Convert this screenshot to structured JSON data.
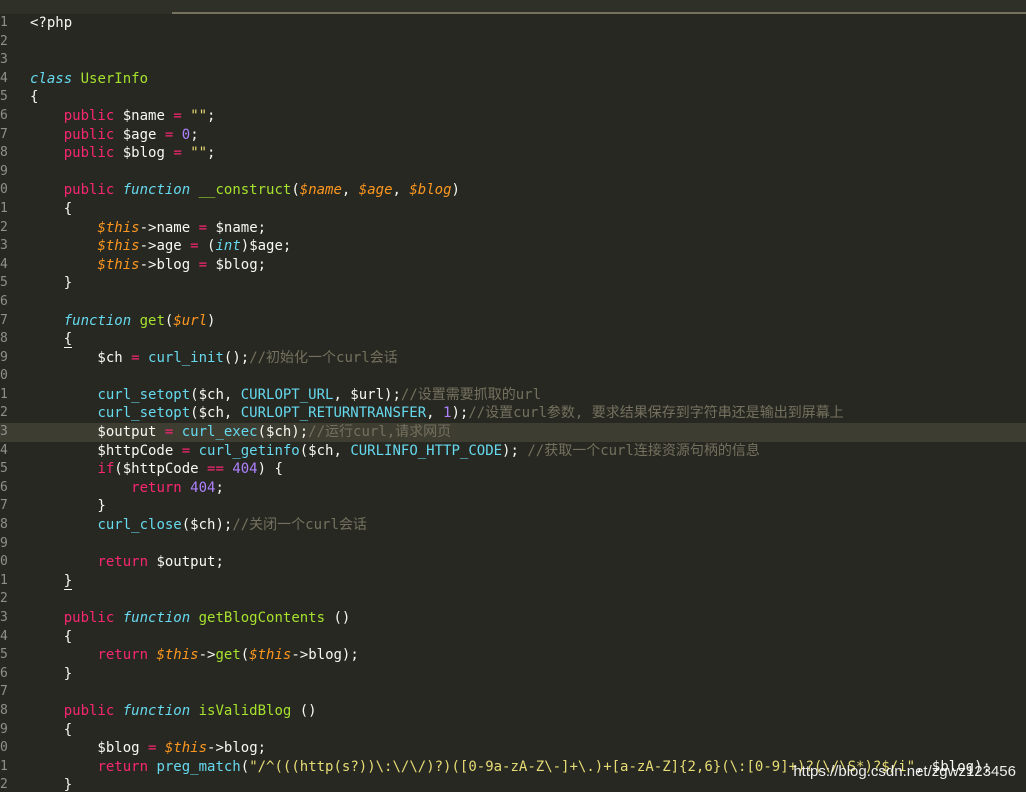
{
  "editor": {
    "current_line": 23,
    "lines": [
      {
        "n": "1",
        "tokens": [
          {
            "t": "<?php",
            "c": ""
          }
        ]
      },
      {
        "n": "2",
        "tokens": []
      },
      {
        "n": "3",
        "tokens": []
      },
      {
        "n": "4",
        "tokens": [
          {
            "t": "class",
            "c": "st"
          },
          {
            "t": " ",
            "c": ""
          },
          {
            "t": "UserInfo",
            "c": "cl"
          }
        ]
      },
      {
        "n": "5",
        "tokens": [
          {
            "t": "{",
            "c": ""
          }
        ]
      },
      {
        "n": "6",
        "tokens": [
          {
            "t": "    ",
            "c": ""
          },
          {
            "t": "public",
            "c": "kw"
          },
          {
            "t": " $name ",
            "c": ""
          },
          {
            "t": "=",
            "c": "kw"
          },
          {
            "t": " ",
            "c": ""
          },
          {
            "t": "\"\"",
            "c": "str"
          },
          {
            "t": ";",
            "c": ""
          }
        ]
      },
      {
        "n": "7",
        "tokens": [
          {
            "t": "    ",
            "c": ""
          },
          {
            "t": "public",
            "c": "kw"
          },
          {
            "t": " $age ",
            "c": ""
          },
          {
            "t": "=",
            "c": "kw"
          },
          {
            "t": " ",
            "c": ""
          },
          {
            "t": "0",
            "c": "num"
          },
          {
            "t": ";",
            "c": ""
          }
        ]
      },
      {
        "n": "8",
        "tokens": [
          {
            "t": "    ",
            "c": ""
          },
          {
            "t": "public",
            "c": "kw"
          },
          {
            "t": " $blog ",
            "c": ""
          },
          {
            "t": "=",
            "c": "kw"
          },
          {
            "t": " ",
            "c": ""
          },
          {
            "t": "\"\"",
            "c": "str"
          },
          {
            "t": ";",
            "c": ""
          }
        ]
      },
      {
        "n": "9",
        "tokens": []
      },
      {
        "n": "0",
        "tokens": [
          {
            "t": "    ",
            "c": ""
          },
          {
            "t": "public",
            "c": "kw"
          },
          {
            "t": " ",
            "c": ""
          },
          {
            "t": "function",
            "c": "st"
          },
          {
            "t": " ",
            "c": ""
          },
          {
            "t": "__construct",
            "c": "fn"
          },
          {
            "t": "(",
            "c": ""
          },
          {
            "t": "$name",
            "c": "arg"
          },
          {
            "t": ", ",
            "c": ""
          },
          {
            "t": "$age",
            "c": "arg"
          },
          {
            "t": ", ",
            "c": ""
          },
          {
            "t": "$blog",
            "c": "arg"
          },
          {
            "t": ")",
            "c": ""
          }
        ]
      },
      {
        "n": "1",
        "tokens": [
          {
            "t": "    {",
            "c": ""
          }
        ]
      },
      {
        "n": "2",
        "tokens": [
          {
            "t": "        ",
            "c": ""
          },
          {
            "t": "$this",
            "c": "arg"
          },
          {
            "t": "->name ",
            "c": ""
          },
          {
            "t": "=",
            "c": "kw"
          },
          {
            "t": " $name;",
            "c": ""
          }
        ]
      },
      {
        "n": "3",
        "tokens": [
          {
            "t": "        ",
            "c": ""
          },
          {
            "t": "$this",
            "c": "arg"
          },
          {
            "t": "->age ",
            "c": ""
          },
          {
            "t": "=",
            "c": "kw"
          },
          {
            "t": " (",
            "c": ""
          },
          {
            "t": "int",
            "c": "st"
          },
          {
            "t": ")$age;",
            "c": ""
          }
        ]
      },
      {
        "n": "4",
        "tokens": [
          {
            "t": "        ",
            "c": ""
          },
          {
            "t": "$this",
            "c": "arg"
          },
          {
            "t": "->blog ",
            "c": ""
          },
          {
            "t": "=",
            "c": "kw"
          },
          {
            "t": " $blog;",
            "c": ""
          }
        ]
      },
      {
        "n": "5",
        "tokens": [
          {
            "t": "    }",
            "c": ""
          }
        ]
      },
      {
        "n": "6",
        "tokens": []
      },
      {
        "n": "7",
        "tokens": [
          {
            "t": "    ",
            "c": ""
          },
          {
            "t": "function",
            "c": "st"
          },
          {
            "t": " ",
            "c": ""
          },
          {
            "t": "get",
            "c": "fn"
          },
          {
            "t": "(",
            "c": ""
          },
          {
            "t": "$url",
            "c": "arg"
          },
          {
            "t": ")",
            "c": ""
          }
        ]
      },
      {
        "n": "8",
        "tokens": [
          {
            "t": "    ",
            "c": ""
          },
          {
            "t": "{",
            "c": "bracket-u"
          }
        ]
      },
      {
        "n": "9",
        "tokens": [
          {
            "t": "        $ch ",
            "c": ""
          },
          {
            "t": "=",
            "c": "kw"
          },
          {
            "t": " ",
            "c": ""
          },
          {
            "t": "curl_init",
            "c": "bi"
          },
          {
            "t": "();",
            "c": ""
          },
          {
            "t": "//初始化一个curl会话",
            "c": "cm"
          }
        ]
      },
      {
        "n": "0",
        "tokens": []
      },
      {
        "n": "1",
        "tokens": [
          {
            "t": "        ",
            "c": ""
          },
          {
            "t": "curl_setopt",
            "c": "bi"
          },
          {
            "t": "($ch, ",
            "c": ""
          },
          {
            "t": "CURLOPT_URL",
            "c": "cs"
          },
          {
            "t": ", $url);",
            "c": ""
          },
          {
            "t": "//设置需要抓取的url",
            "c": "cm"
          }
        ]
      },
      {
        "n": "2",
        "tokens": [
          {
            "t": "        ",
            "c": ""
          },
          {
            "t": "curl_setopt",
            "c": "bi"
          },
          {
            "t": "($ch, ",
            "c": ""
          },
          {
            "t": "CURLOPT_RETURNTRANSFER",
            "c": "cs"
          },
          {
            "t": ", ",
            "c": ""
          },
          {
            "t": "1",
            "c": "num"
          },
          {
            "t": ");",
            "c": ""
          },
          {
            "t": "//设置curl参数, 要求结果保存到字符串还是输出到屏幕上",
            "c": "cm"
          }
        ]
      },
      {
        "n": "3",
        "tokens": [
          {
            "t": "        $output ",
            "c": ""
          },
          {
            "t": "=",
            "c": "kw"
          },
          {
            "t": " ",
            "c": ""
          },
          {
            "t": "curl_exec",
            "c": "bi"
          },
          {
            "t": "($ch);",
            "c": ""
          },
          {
            "t": "//运行curl,请求网页",
            "c": "cm"
          }
        ]
      },
      {
        "n": "4",
        "tokens": [
          {
            "t": "        $httpCode ",
            "c": ""
          },
          {
            "t": "=",
            "c": "kw"
          },
          {
            "t": " ",
            "c": ""
          },
          {
            "t": "curl_getinfo",
            "c": "bi"
          },
          {
            "t": "($ch, ",
            "c": ""
          },
          {
            "t": "CURLINFO_HTTP_CODE",
            "c": "cs"
          },
          {
            "t": "); ",
            "c": ""
          },
          {
            "t": "//获取一个curl连接资源句柄的信息",
            "c": "cm"
          }
        ]
      },
      {
        "n": "5",
        "tokens": [
          {
            "t": "        ",
            "c": ""
          },
          {
            "t": "if",
            "c": "kw"
          },
          {
            "t": "($httpCode ",
            "c": ""
          },
          {
            "t": "==",
            "c": "kw"
          },
          {
            "t": " ",
            "c": ""
          },
          {
            "t": "404",
            "c": "num"
          },
          {
            "t": ") {",
            "c": ""
          }
        ]
      },
      {
        "n": "6",
        "tokens": [
          {
            "t": "            ",
            "c": ""
          },
          {
            "t": "return",
            "c": "kw"
          },
          {
            "t": " ",
            "c": ""
          },
          {
            "t": "404",
            "c": "num"
          },
          {
            "t": ";",
            "c": ""
          }
        ]
      },
      {
        "n": "7",
        "tokens": [
          {
            "t": "        }",
            "c": ""
          }
        ]
      },
      {
        "n": "8",
        "tokens": [
          {
            "t": "        ",
            "c": ""
          },
          {
            "t": "curl_close",
            "c": "bi"
          },
          {
            "t": "($ch);",
            "c": ""
          },
          {
            "t": "//关闭一个curl会话",
            "c": "cm"
          }
        ]
      },
      {
        "n": "9",
        "tokens": []
      },
      {
        "n": "0",
        "tokens": [
          {
            "t": "        ",
            "c": ""
          },
          {
            "t": "return",
            "c": "kw"
          },
          {
            "t": " $output;",
            "c": ""
          }
        ]
      },
      {
        "n": "1",
        "tokens": [
          {
            "t": "    ",
            "c": ""
          },
          {
            "t": "}",
            "c": "bracket-u"
          }
        ]
      },
      {
        "n": "2",
        "tokens": []
      },
      {
        "n": "3",
        "tokens": [
          {
            "t": "    ",
            "c": ""
          },
          {
            "t": "public",
            "c": "kw"
          },
          {
            "t": " ",
            "c": ""
          },
          {
            "t": "function",
            "c": "st"
          },
          {
            "t": " ",
            "c": ""
          },
          {
            "t": "getBlogContents",
            "c": "fn"
          },
          {
            "t": " ()",
            "c": ""
          }
        ]
      },
      {
        "n": "4",
        "tokens": [
          {
            "t": "    {",
            "c": ""
          }
        ]
      },
      {
        "n": "5",
        "tokens": [
          {
            "t": "        ",
            "c": ""
          },
          {
            "t": "return",
            "c": "kw"
          },
          {
            "t": " ",
            "c": ""
          },
          {
            "t": "$this",
            "c": "arg"
          },
          {
            "t": "->",
            "c": ""
          },
          {
            "t": "get",
            "c": "fn"
          },
          {
            "t": "(",
            "c": ""
          },
          {
            "t": "$this",
            "c": "arg"
          },
          {
            "t": "->blog);",
            "c": ""
          }
        ]
      },
      {
        "n": "6",
        "tokens": [
          {
            "t": "    }",
            "c": ""
          }
        ]
      },
      {
        "n": "7",
        "tokens": []
      },
      {
        "n": "8",
        "tokens": [
          {
            "t": "    ",
            "c": ""
          },
          {
            "t": "public",
            "c": "kw"
          },
          {
            "t": " ",
            "c": ""
          },
          {
            "t": "function",
            "c": "st"
          },
          {
            "t": " ",
            "c": ""
          },
          {
            "t": "isValidBlog",
            "c": "fn"
          },
          {
            "t": " ()",
            "c": ""
          }
        ]
      },
      {
        "n": "9",
        "tokens": [
          {
            "t": "    {",
            "c": ""
          }
        ]
      },
      {
        "n": "0",
        "tokens": [
          {
            "t": "        $blog ",
            "c": ""
          },
          {
            "t": "=",
            "c": "kw"
          },
          {
            "t": " ",
            "c": ""
          },
          {
            "t": "$this",
            "c": "arg"
          },
          {
            "t": "->blog;",
            "c": ""
          }
        ]
      },
      {
        "n": "1",
        "tokens": [
          {
            "t": "        ",
            "c": ""
          },
          {
            "t": "return",
            "c": "kw"
          },
          {
            "t": " ",
            "c": ""
          },
          {
            "t": "preg_match",
            "c": "bi"
          },
          {
            "t": "(",
            "c": ""
          },
          {
            "t": "\"/^(((http(s?))\\:\\/\\/)?)([0-9a-zA-Z\\-]+\\.)+[a-zA-Z]{2,6}(\\:[0-9]+)?(\\/\\S*)?$/i\"",
            "c": "str"
          },
          {
            "t": ", $blog);",
            "c": ""
          }
        ]
      },
      {
        "n": "2",
        "tokens": [
          {
            "t": "    }",
            "c": ""
          }
        ]
      }
    ]
  },
  "watermark": "https://blog.csdn.net/zgwz123456"
}
